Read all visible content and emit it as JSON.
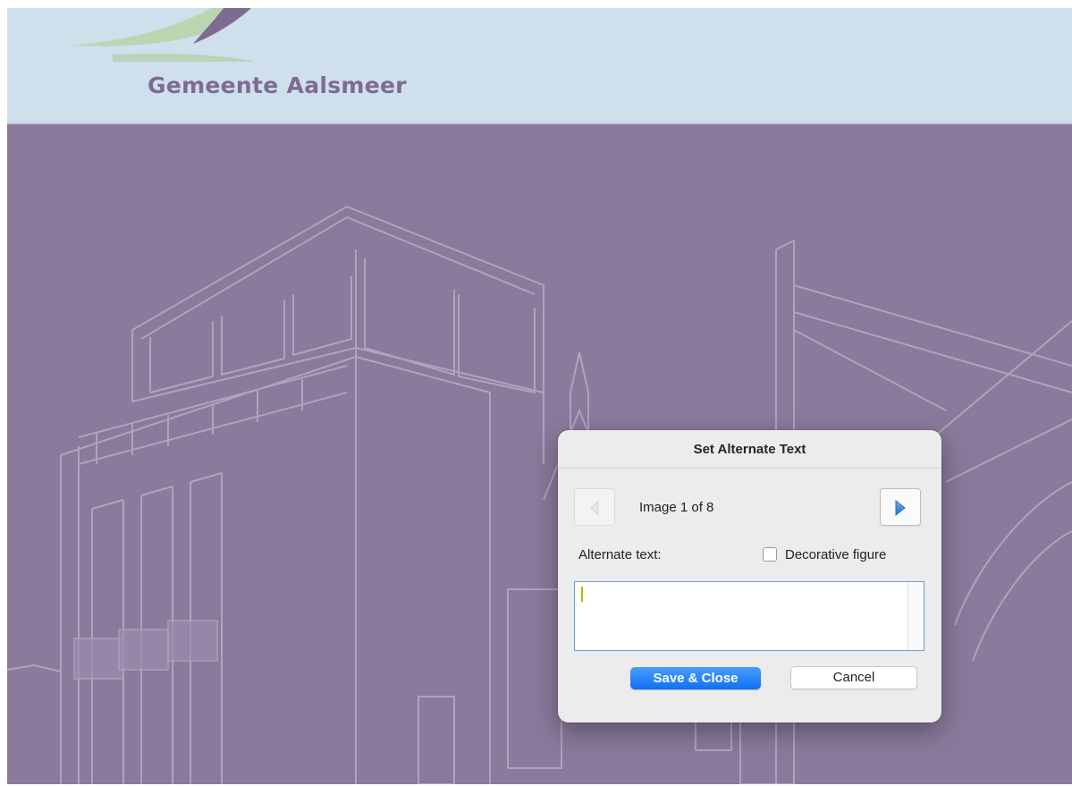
{
  "header": {
    "org_name": "Gemeente Aalsmeer"
  },
  "dialog": {
    "title": "Set Alternate Text",
    "counter": "Image 1 of 8",
    "alt_label": "Alternate text:",
    "decorative_label": "Decorative figure",
    "decorative_checked": false,
    "alt_text_value": "",
    "save_label": "Save & Close",
    "cancel_label": "Cancel"
  },
  "icons": {
    "prev": "triangle-left-icon",
    "next": "triangle-right-icon"
  },
  "colors": {
    "background_purple": "#8a7a9c",
    "header_blue": "#cfe0ec",
    "brand_purple": "#7d6b93",
    "accent_blue": "#0f71f0"
  }
}
